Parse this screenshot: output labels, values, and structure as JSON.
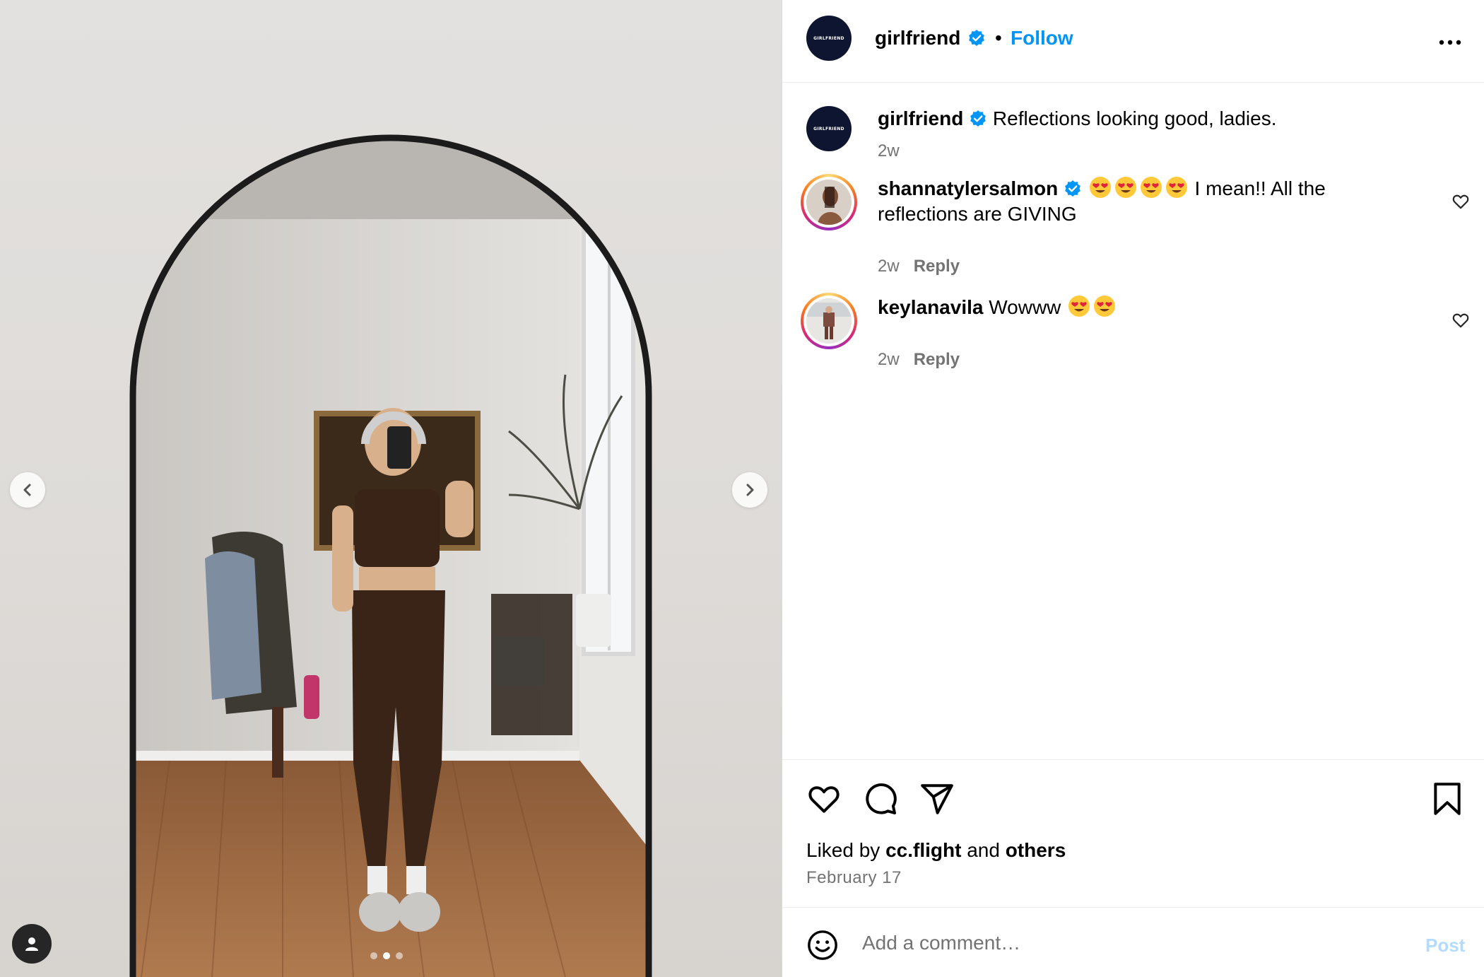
{
  "post": {
    "slide_count": 3,
    "active_slide": 2
  },
  "header": {
    "username": "girlfriend",
    "brand_mark": "GIRLFRIEND",
    "separator": "•",
    "follow_label": "Follow",
    "verified": true
  },
  "caption": {
    "username": "girlfriend",
    "text": "Reflections looking good, ladies.",
    "time": "2w"
  },
  "comments": [
    {
      "username": "shannatylersalmon",
      "verified": true,
      "emoji_count": 4,
      "text_line1": "I mean!! All the",
      "text_line2": "reflections are GIVING",
      "time": "2w",
      "reply_label": "Reply"
    },
    {
      "username": "keylanavila",
      "verified": false,
      "text": "Wowww",
      "emoji_count": 2,
      "time": "2w",
      "reply_label": "Reply"
    }
  ],
  "likes": {
    "prefix": "Liked by",
    "user": "cc.flight",
    "joiner": "and",
    "others": "others"
  },
  "date": "February 17",
  "composer": {
    "placeholder": "Add a comment…",
    "post_label": "Post"
  },
  "colors": {
    "accent": "#0095f6",
    "verified": "#0095f6",
    "brand_avatar": "#0e1530",
    "muted_text": "#737373",
    "post_disabled": "#b3dbff"
  },
  "icons": {
    "prev": "chevron-left-icon",
    "next": "chevron-right-icon",
    "tag": "user-tag-icon",
    "more": "more-horizontal-icon",
    "like": "heart-icon",
    "comment": "comment-bubble-icon",
    "share": "paper-plane-icon",
    "save": "bookmark-icon",
    "emoji": "smiley-icon"
  }
}
